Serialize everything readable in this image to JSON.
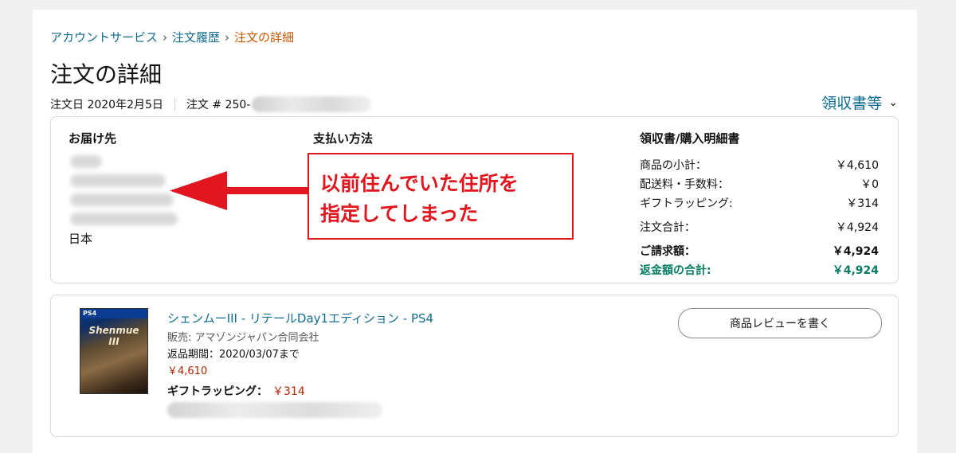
{
  "breadcrumb": {
    "items": [
      "アカウントサービス",
      "注文履歴"
    ],
    "current": "注文の詳細",
    "separator": "›"
  },
  "page_title": "注文の詳細",
  "order_meta": {
    "date": "注文日 2020年2月5日",
    "number_prefix": "注文 # 250-"
  },
  "receipt_link": "領収書等",
  "shipping": {
    "heading": "お届け先",
    "country": "日本"
  },
  "payment": {
    "heading": "支払い方法"
  },
  "summary": {
    "heading": "領収書/購入明細書",
    "rows": [
      {
        "label": "商品の小計：",
        "value": "￥4,610"
      },
      {
        "label": "配送料・手数料：",
        "value": "￥0"
      },
      {
        "label": "ギフトラッピング:",
        "value": "￥314"
      },
      {
        "label": "注文合計：",
        "value": "￥4,924"
      },
      {
        "label": "ご請求額：",
        "value": "￥4,924"
      },
      {
        "label": "返金額の合計:",
        "value": "￥4,924"
      }
    ]
  },
  "annotation": {
    "line1": "以前住んでいた住所を",
    "line2": "指定してしまった",
    "color": "#e2161e"
  },
  "product": {
    "badge": "PS4",
    "logo_text": "Shenmue III",
    "title": "シェンムーIII - リテールDay1エディション - PS4",
    "seller": "販売: アマゾンジャパン合同会社",
    "return_period": "返品期間：2020/03/07まで",
    "price": "￥4,610",
    "gift_label": "ギフトラッピング：",
    "gift_value": "￥314",
    "review_button": "商品レビューを書く"
  },
  "colors": {
    "link": "#0f6b8f",
    "current_crumb": "#c45500",
    "price": "#b12704",
    "refund": "#067d62"
  }
}
